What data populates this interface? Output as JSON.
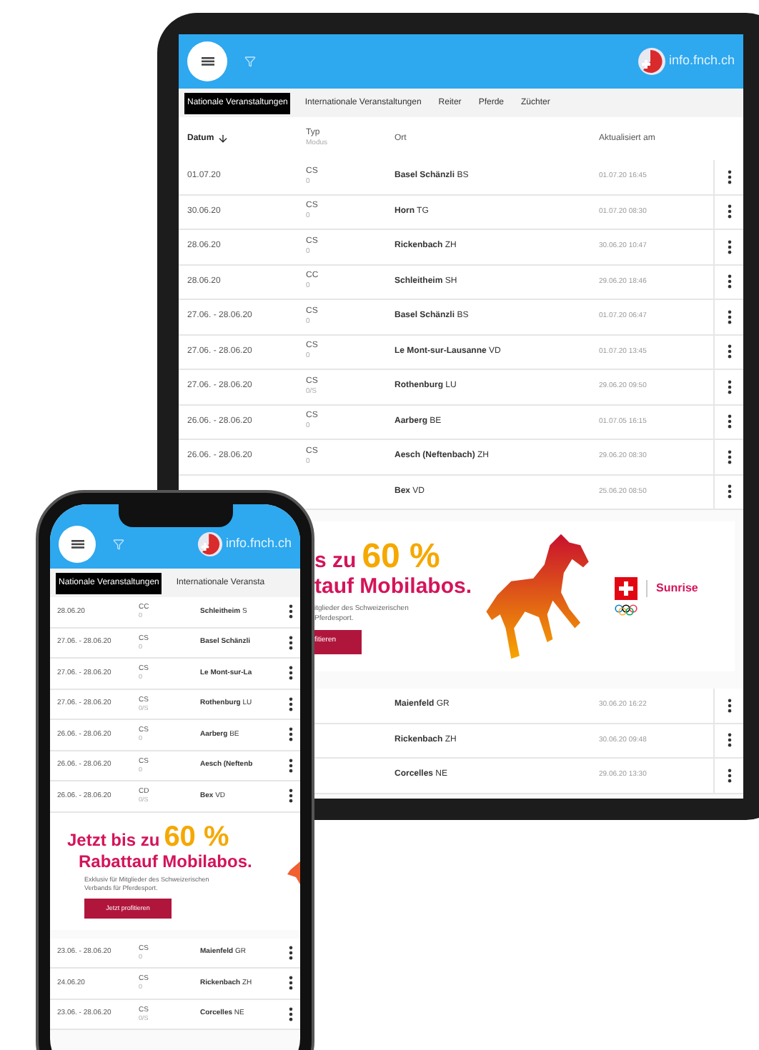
{
  "tablet": {
    "header": {
      "logo_text": "info.fnch.ch"
    },
    "tabs": [
      {
        "label": "Nationale Veranstaltungen",
        "selected": true
      },
      {
        "label": "Internationale Veranstaltungen",
        "selected": false
      },
      {
        "label": "Reiter",
        "selected": false
      },
      {
        "label": "Pferde",
        "selected": false
      },
      {
        "label": "Züchter",
        "selected": false
      }
    ],
    "columns": {
      "date": "Datum",
      "type": "Typ",
      "mode": "Modus",
      "place": "Ort",
      "updated": "Aktualisiert am"
    },
    "rows": [
      {
        "date": "01.07.20",
        "type": "CS",
        "mode": "0",
        "place": "**Basel Schänzli** BS",
        "updated": "01.07.20 16:45"
      },
      {
        "date": "30.06.20",
        "type": "CS",
        "mode": "0",
        "place": "**Horn** TG",
        "updated": "01.07.20 08:30"
      },
      {
        "date": "28.06.20",
        "type": "CS",
        "mode": "0",
        "place": "**Rickenbach** ZH",
        "updated": "30.06.20 10:47"
      },
      {
        "date": "28.06.20",
        "type": "CC",
        "mode": "0",
        "place": "**Schleitheim** SH",
        "updated": "29.06.20 18:46"
      },
      {
        "date": "27.06. - 28.06.20",
        "type": "CS",
        "mode": "0",
        "place": "**Basel Schänzli** BS",
        "updated": "01.07.20 06:47"
      },
      {
        "date": "27.06. - 28.06.20",
        "type": "CS",
        "mode": "0",
        "place": "**Le Mont-sur-Lausanne** VD",
        "updated": "01.07.20 13:45"
      },
      {
        "date": "27.06. - 28.06.20",
        "type": "CS",
        "mode": "0/S",
        "place": "**Rothenburg** LU",
        "updated": "29.06.20 09:50"
      },
      {
        "date": "26.06. - 28.06.20",
        "type": "CS",
        "mode": "0",
        "place": "**Aarberg** BE",
        "updated": "01.07.05 16:15"
      },
      {
        "date": "26.06. - 28.06.20",
        "type": "CS",
        "mode": "0",
        "place": "**Aesch (Neftenbach)** ZH",
        "updated": "29.06.20 08:30"
      },
      {
        "place": "**Bex** VD",
        "updated": "25.06.20 08:50"
      }
    ],
    "ad": {
      "headline_1": "s zu",
      "percent": "60 %",
      "headline_2": "tauf Mobilabos.",
      "body": [
        "itglieder des Schweizerischen",
        "Pferdesport."
      ],
      "button": "fitieren",
      "brand": "Sunrise"
    },
    "rows_after_ad": [
      {
        "place": "**Maienfeld** GR",
        "updated": "30.06.20 16:22"
      },
      {
        "place": "**Rickenbach** ZH",
        "updated": "30.06.20 09:48"
      },
      {
        "place": "**Corcelles** NE",
        "updated": "29.06.20 13:30"
      }
    ]
  },
  "phone": {
    "header": {
      "logo_text": "info.fnch.ch"
    },
    "tabs": [
      {
        "label": "Nationale Veranstaltungen",
        "selected": true
      },
      {
        "label": "Internationale Veransta",
        "selected": false
      }
    ],
    "rows": [
      {
        "date": "28.06.20",
        "type": "CC",
        "mode": "0",
        "place": "**Schleitheim** S"
      },
      {
        "date": "27.06. - 28.06.20",
        "type": "CS",
        "mode": "0",
        "place": "**Basel Schänzli**"
      },
      {
        "date": "27.06. - 28.06.20",
        "type": "CS",
        "mode": "0",
        "place": "**Le Mont-sur-La**"
      },
      {
        "date": "27.06. - 28.06.20",
        "type": "CS",
        "mode": "0/S",
        "place": "**Rothenburg** LU"
      },
      {
        "date": "26.06. - 28.06.20",
        "type": "CS",
        "mode": "0",
        "place": "**Aarberg** BE"
      },
      {
        "date": "26.06. - 28.06.20",
        "type": "CS",
        "mode": "0",
        "place": "**Aesch (Neftenb**"
      },
      {
        "date": "26.06. - 28.06.20",
        "type": "CD",
        "mode": "0/S",
        "place": "**Bex** VD"
      }
    ],
    "ad": {
      "headline_1": "Jetzt bis zu",
      "percent": "60 %",
      "headline_2": "Rabattauf Mobilabos.",
      "body": "Exklusiv für Mitglieder des Schweizerischen Verbands für Pferdesport.",
      "button": "Jetzt profitieren"
    },
    "rows_after_ad": [
      {
        "date": "23.06. - 28.06.20",
        "type": "CS",
        "mode": "0",
        "place": "**Maienfeld** GR"
      },
      {
        "date": "24.06.20",
        "type": "CS",
        "mode": "0",
        "place": "**Rickenbach** ZH"
      },
      {
        "date": "23.06. - 28.06.20",
        "type": "CS",
        "mode": "0/S",
        "place": "**Corcelles** NE"
      }
    ]
  }
}
